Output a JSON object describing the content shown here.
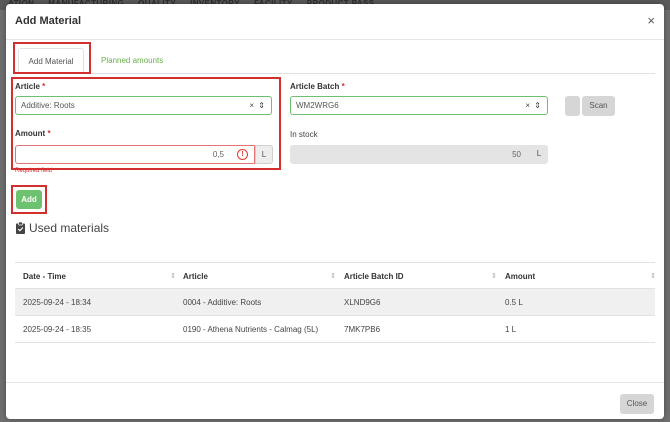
{
  "backdrop": {
    "nav_items": [
      "ATION",
      "MANUFACTURING",
      "QUALITY",
      "INVENTORY",
      "FACILITY",
      "PRODUCT PASS"
    ]
  },
  "modal": {
    "title": "Add Material",
    "close_icon": "×"
  },
  "tabs": [
    {
      "label": "Add Material",
      "active": true
    },
    {
      "label": "Planned amounts",
      "active": false
    }
  ],
  "form": {
    "article": {
      "label": "Article",
      "required_mark": "*",
      "value": "Additive: Roots",
      "controls": "× ⇕"
    },
    "article_batch": {
      "label": "Article Batch",
      "required_mark": "*",
      "value": "WM2WRG6",
      "controls": "× ⇕"
    },
    "amount": {
      "label": "Amount",
      "required_mark": "*",
      "value": "0,5",
      "unit": "L",
      "error": "Required field"
    },
    "in_stock": {
      "label": "In stock",
      "value": "50",
      "unit": "L"
    },
    "scan_label": "Scan",
    "add_label": "Add"
  },
  "used_materials": {
    "title": "Used materials",
    "columns": [
      "Date - Time",
      "Article",
      "Article Batch ID",
      "Amount"
    ],
    "sort_icon": "⇕",
    "rows": [
      [
        "2025-09-24 - 18:34",
        "0004 - Additive: Roots",
        "XLND9G6",
        "0.5 L"
      ],
      [
        "2025-09-24 - 18:35",
        "0190 - Athena Nutrients - Calmag (5L)",
        "7MK7PB6",
        "1 L"
      ]
    ]
  },
  "footer": {
    "close_label": "Close"
  },
  "colors": {
    "accent_green": "#6cc26e",
    "error_red": "#d32f2f",
    "tab_link": "#6ab04c"
  }
}
